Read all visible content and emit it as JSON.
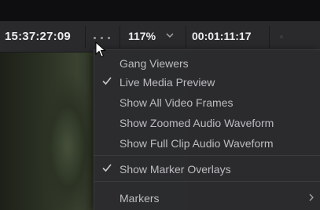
{
  "toolbar": {
    "timecode": "15:37:27:09",
    "zoom": "117%",
    "duration": "00:01:11:17",
    "options_icon": "more-options-icon",
    "zoom_icon": "chevron-down-icon"
  },
  "menu": {
    "items": [
      {
        "label": "Gang Viewers",
        "checked": false
      },
      {
        "label": "Live Media Preview",
        "checked": true
      },
      {
        "label": "Show All Video Frames",
        "checked": false
      },
      {
        "label": "Show Zoomed Audio Waveform",
        "checked": false
      },
      {
        "label": "Show Full Clip Audio Waveform",
        "checked": false
      },
      {
        "label": "Show Marker Overlays",
        "checked": true
      },
      {
        "label": "Markers",
        "checked": false,
        "submenu": true
      }
    ],
    "check_icon": "checkmark-icon",
    "submenu_icon": "chevron-right-icon"
  },
  "colors": {
    "toolbar_bg": "#2a2a2d",
    "menu_bg": "#2c2c30",
    "menu_text": "#bdbdc1",
    "toolbar_text": "#ececec"
  }
}
